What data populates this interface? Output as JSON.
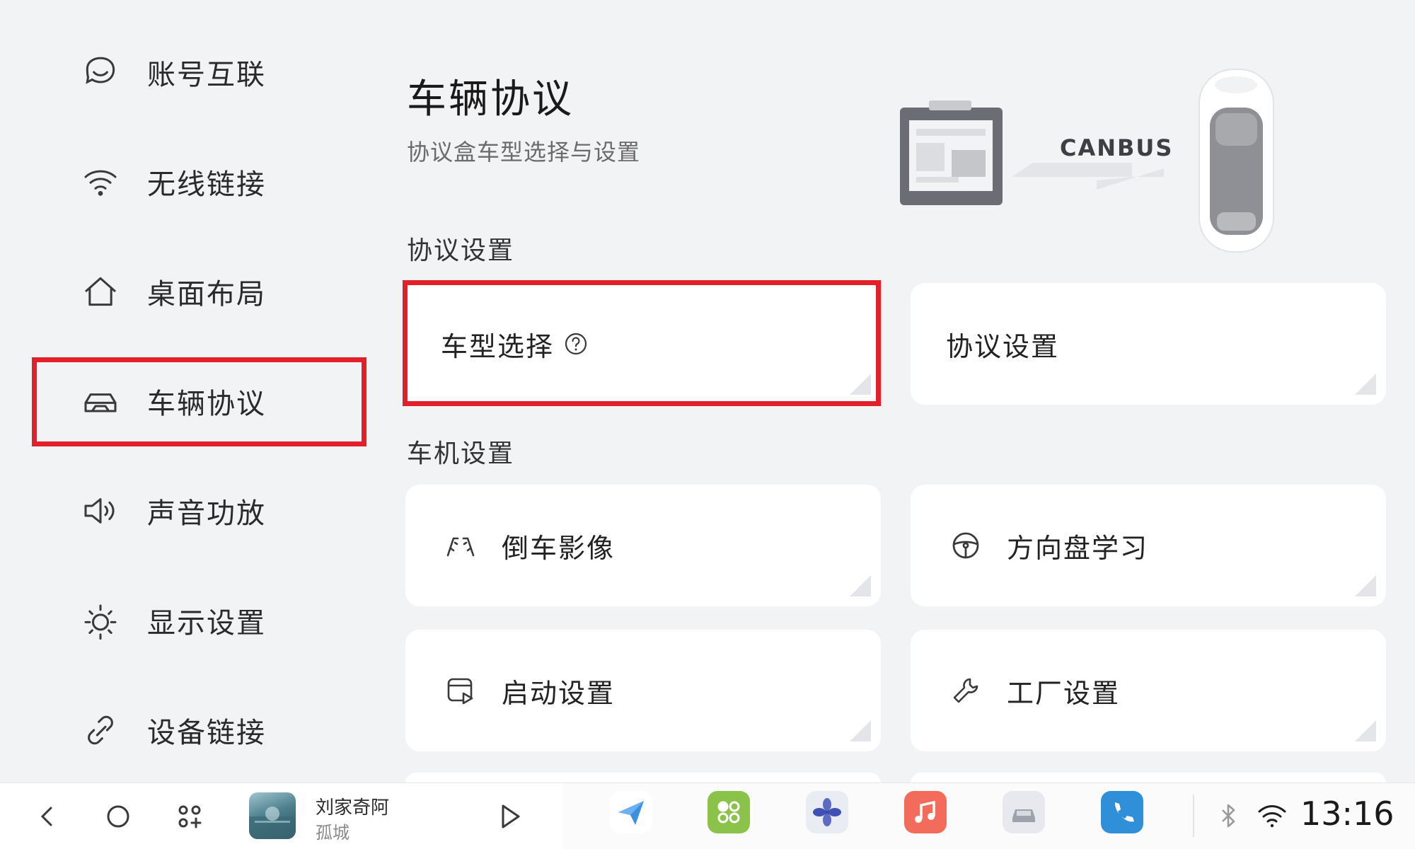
{
  "sidebar": {
    "items": [
      {
        "label": "账号互联",
        "icon": "account-link-icon"
      },
      {
        "label": "无线链接",
        "icon": "wifi-icon"
      },
      {
        "label": "桌面布局",
        "icon": "home-icon"
      },
      {
        "label": "车辆协议",
        "icon": "car-icon",
        "active": true
      },
      {
        "label": "声音功放",
        "icon": "speaker-icon"
      },
      {
        "label": "显示设置",
        "icon": "brightness-icon"
      },
      {
        "label": "设备链接",
        "icon": "link-icon"
      }
    ]
  },
  "header": {
    "title": "车辆协议",
    "subtitle": "协议盒车型选择与设置",
    "hero_label": "CANBUS"
  },
  "sections": {
    "protocol": {
      "label": "协议设置",
      "cards": [
        {
          "label": "车型选择",
          "icon": "help-circle-icon"
        },
        {
          "label": "协议设置"
        }
      ]
    },
    "head_unit": {
      "label": "车机设置",
      "cards": [
        {
          "label": "倒车影像",
          "icon": "reverse-camera-icon"
        },
        {
          "label": "方向盘学习",
          "icon": "steering-wheel-icon"
        },
        {
          "label": "启动设置",
          "icon": "startup-icon"
        },
        {
          "label": "工厂设置",
          "icon": "wrench-icon"
        }
      ]
    }
  },
  "dock": {
    "nav": [
      "back-icon",
      "home-circle-icon",
      "apps-grid-icon"
    ],
    "media": {
      "title": "刘家奇阿",
      "artist": "孤城"
    },
    "apps": [
      "navigation-app",
      "app-grid-app",
      "fan-app",
      "music-app",
      "car-app",
      "phone-app"
    ],
    "status": {
      "bluetooth": "bluetooth-icon",
      "wifi": "wifi-icon",
      "time": "13:16"
    }
  },
  "colors": {
    "background": "#f2f3f5",
    "card": "#ffffff",
    "highlight": "#e3202a",
    "music_app": "#f26b5b",
    "grid_app": "#8bc34a",
    "phone_app": "#2f8fd8"
  }
}
